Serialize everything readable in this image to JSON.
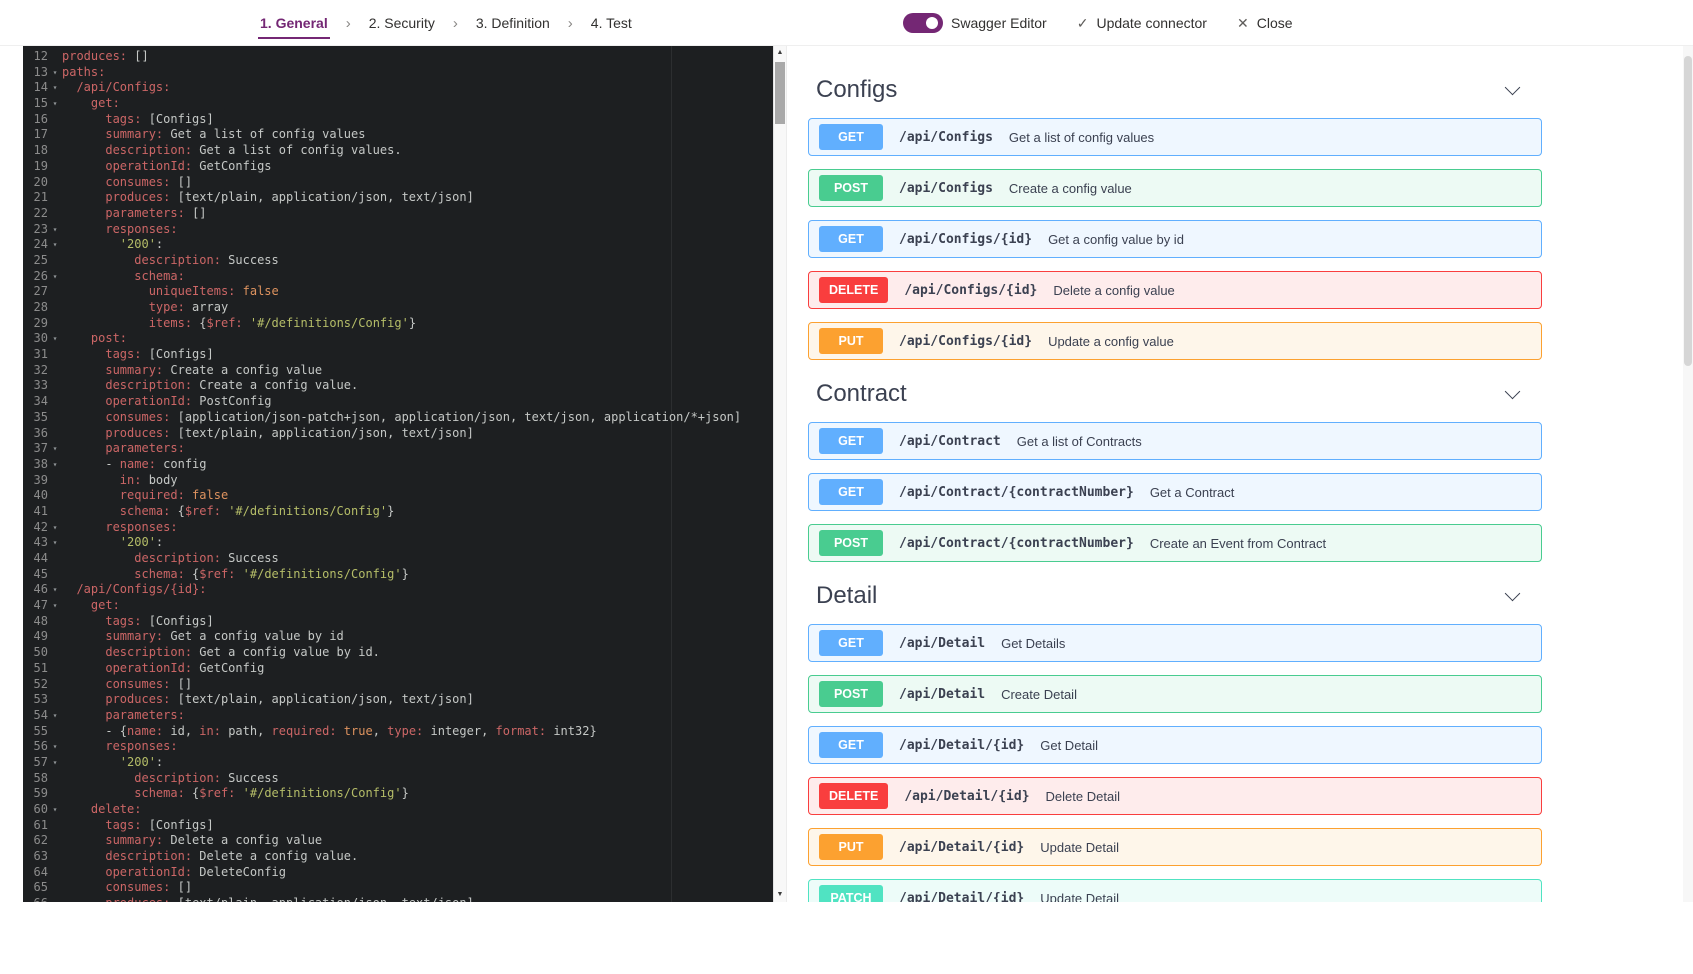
{
  "header": {
    "step_separator": "›",
    "steps": [
      {
        "label": "1. General",
        "active": true
      },
      {
        "label": "2. Security",
        "active": false
      },
      {
        "label": "3. Definition",
        "active": false
      },
      {
        "label": "4. Test",
        "active": false
      }
    ],
    "toggle": {
      "label": "Swagger Editor",
      "on": true
    },
    "actions": [
      {
        "icon": "check-icon",
        "glyph": "✓",
        "label": "Update connector"
      },
      {
        "icon": "close-icon",
        "glyph": "✕",
        "label": "Close"
      }
    ]
  },
  "scrollbar": {
    "up": "▲",
    "down": "▼"
  },
  "editor": {
    "lines": [
      {
        "n": 12,
        "f": 0,
        "t": [
          [
            "k",
            "produces:"
          ],
          [
            "p",
            " []"
          ]
        ]
      },
      {
        "n": 13,
        "f": 1,
        "t": [
          [
            "k",
            "paths:"
          ]
        ]
      },
      {
        "n": 14,
        "f": 1,
        "t": [
          [
            "p",
            "  "
          ],
          [
            "k",
            "/api/Configs:"
          ]
        ]
      },
      {
        "n": 15,
        "f": 1,
        "t": [
          [
            "p",
            "    "
          ],
          [
            "k",
            "get:"
          ]
        ]
      },
      {
        "n": 16,
        "f": 0,
        "t": [
          [
            "p",
            "      "
          ],
          [
            "k",
            "tags:"
          ],
          [
            "p",
            " [Configs]"
          ]
        ]
      },
      {
        "n": 17,
        "f": 0,
        "t": [
          [
            "p",
            "      "
          ],
          [
            "k",
            "summary:"
          ],
          [
            "p",
            " Get a list of config values"
          ]
        ]
      },
      {
        "n": 18,
        "f": 0,
        "t": [
          [
            "p",
            "      "
          ],
          [
            "k",
            "description:"
          ],
          [
            "p",
            " Get a list of config values."
          ]
        ]
      },
      {
        "n": 19,
        "f": 0,
        "t": [
          [
            "p",
            "      "
          ],
          [
            "k",
            "operationId:"
          ],
          [
            "p",
            " GetConfigs"
          ]
        ]
      },
      {
        "n": 20,
        "f": 0,
        "t": [
          [
            "p",
            "      "
          ],
          [
            "k",
            "consumes:"
          ],
          [
            "p",
            " []"
          ]
        ]
      },
      {
        "n": 21,
        "f": 0,
        "t": [
          [
            "p",
            "      "
          ],
          [
            "k",
            "produces:"
          ],
          [
            "p",
            " [text/plain, application/json, text/json]"
          ]
        ]
      },
      {
        "n": 22,
        "f": 0,
        "t": [
          [
            "p",
            "      "
          ],
          [
            "k",
            "parameters:"
          ],
          [
            "p",
            " []"
          ]
        ]
      },
      {
        "n": 23,
        "f": 1,
        "t": [
          [
            "p",
            "      "
          ],
          [
            "k",
            "responses:"
          ]
        ]
      },
      {
        "n": 24,
        "f": 1,
        "t": [
          [
            "p",
            "        "
          ],
          [
            "s",
            "'200'"
          ],
          [
            "p",
            ":"
          ]
        ]
      },
      {
        "n": 25,
        "f": 0,
        "t": [
          [
            "p",
            "          "
          ],
          [
            "k",
            "description:"
          ],
          [
            "p",
            " Success"
          ]
        ]
      },
      {
        "n": 26,
        "f": 1,
        "t": [
          [
            "p",
            "          "
          ],
          [
            "k",
            "schema:"
          ]
        ]
      },
      {
        "n": 27,
        "f": 0,
        "t": [
          [
            "p",
            "            "
          ],
          [
            "k",
            "uniqueItems:"
          ],
          [
            "c",
            " false"
          ]
        ]
      },
      {
        "n": 28,
        "f": 0,
        "t": [
          [
            "p",
            "            "
          ],
          [
            "k",
            "type:"
          ],
          [
            "p",
            " array"
          ]
        ]
      },
      {
        "n": 29,
        "f": 0,
        "t": [
          [
            "p",
            "            "
          ],
          [
            "k",
            "items:"
          ],
          [
            "p",
            " {"
          ],
          [
            "k",
            "$ref:"
          ],
          [
            "p",
            " "
          ],
          [
            "s",
            "'#/definitions/Config'"
          ],
          [
            "p",
            "}"
          ]
        ]
      },
      {
        "n": 30,
        "f": 1,
        "t": [
          [
            "p",
            "    "
          ],
          [
            "k",
            "post:"
          ]
        ]
      },
      {
        "n": 31,
        "f": 0,
        "t": [
          [
            "p",
            "      "
          ],
          [
            "k",
            "tags:"
          ],
          [
            "p",
            " [Configs]"
          ]
        ]
      },
      {
        "n": 32,
        "f": 0,
        "t": [
          [
            "p",
            "      "
          ],
          [
            "k",
            "summary:"
          ],
          [
            "p",
            " Create a config value"
          ]
        ]
      },
      {
        "n": 33,
        "f": 0,
        "t": [
          [
            "p",
            "      "
          ],
          [
            "k",
            "description:"
          ],
          [
            "p",
            " Create a config value."
          ]
        ]
      },
      {
        "n": 34,
        "f": 0,
        "t": [
          [
            "p",
            "      "
          ],
          [
            "k",
            "operationId:"
          ],
          [
            "p",
            " PostConfig"
          ]
        ]
      },
      {
        "n": 35,
        "f": 0,
        "t": [
          [
            "p",
            "      "
          ],
          [
            "k",
            "consumes:"
          ],
          [
            "p",
            " [application/json-patch+json, application/json, text/json, application/*+json]"
          ]
        ]
      },
      {
        "n": 36,
        "f": 0,
        "t": [
          [
            "p",
            "      "
          ],
          [
            "k",
            "produces:"
          ],
          [
            "p",
            " [text/plain, application/json, text/json]"
          ]
        ]
      },
      {
        "n": 37,
        "f": 1,
        "t": [
          [
            "p",
            "      "
          ],
          [
            "k",
            "parameters:"
          ]
        ]
      },
      {
        "n": 38,
        "f": 1,
        "t": [
          [
            "p",
            "      - "
          ],
          [
            "k",
            "name:"
          ],
          [
            "p",
            " config"
          ]
        ]
      },
      {
        "n": 39,
        "f": 0,
        "t": [
          [
            "p",
            "        "
          ],
          [
            "k",
            "in:"
          ],
          [
            "p",
            " body"
          ]
        ]
      },
      {
        "n": 40,
        "f": 0,
        "t": [
          [
            "p",
            "        "
          ],
          [
            "k",
            "required:"
          ],
          [
            "c",
            " false"
          ]
        ]
      },
      {
        "n": 41,
        "f": 0,
        "t": [
          [
            "p",
            "        "
          ],
          [
            "k",
            "schema:"
          ],
          [
            "p",
            " {"
          ],
          [
            "k",
            "$ref:"
          ],
          [
            "p",
            " "
          ],
          [
            "s",
            "'#/definitions/Config'"
          ],
          [
            "p",
            "}"
          ]
        ]
      },
      {
        "n": 42,
        "f": 1,
        "t": [
          [
            "p",
            "      "
          ],
          [
            "k",
            "responses:"
          ]
        ]
      },
      {
        "n": 43,
        "f": 1,
        "t": [
          [
            "p",
            "        "
          ],
          [
            "s",
            "'200'"
          ],
          [
            "p",
            ":"
          ]
        ]
      },
      {
        "n": 44,
        "f": 0,
        "t": [
          [
            "p",
            "          "
          ],
          [
            "k",
            "description:"
          ],
          [
            "p",
            " Success"
          ]
        ]
      },
      {
        "n": 45,
        "f": 0,
        "t": [
          [
            "p",
            "          "
          ],
          [
            "k",
            "schema:"
          ],
          [
            "p",
            " {"
          ],
          [
            "k",
            "$ref:"
          ],
          [
            "p",
            " "
          ],
          [
            "s",
            "'#/definitions/Config'"
          ],
          [
            "p",
            "}"
          ]
        ]
      },
      {
        "n": 46,
        "f": 1,
        "t": [
          [
            "p",
            "  "
          ],
          [
            "k",
            "/api/Configs/{id}:"
          ]
        ]
      },
      {
        "n": 47,
        "f": 1,
        "t": [
          [
            "p",
            "    "
          ],
          [
            "k",
            "get:"
          ]
        ]
      },
      {
        "n": 48,
        "f": 0,
        "t": [
          [
            "p",
            "      "
          ],
          [
            "k",
            "tags:"
          ],
          [
            "p",
            " [Configs]"
          ]
        ]
      },
      {
        "n": 49,
        "f": 0,
        "t": [
          [
            "p",
            "      "
          ],
          [
            "k",
            "summary:"
          ],
          [
            "p",
            " Get a config value by id"
          ]
        ]
      },
      {
        "n": 50,
        "f": 0,
        "t": [
          [
            "p",
            "      "
          ],
          [
            "k",
            "description:"
          ],
          [
            "p",
            " Get a config value by id."
          ]
        ]
      },
      {
        "n": 51,
        "f": 0,
        "t": [
          [
            "p",
            "      "
          ],
          [
            "k",
            "operationId:"
          ],
          [
            "p",
            " GetConfig"
          ]
        ]
      },
      {
        "n": 52,
        "f": 0,
        "t": [
          [
            "p",
            "      "
          ],
          [
            "k",
            "consumes:"
          ],
          [
            "p",
            " []"
          ]
        ]
      },
      {
        "n": 53,
        "f": 0,
        "t": [
          [
            "p",
            "      "
          ],
          [
            "k",
            "produces:"
          ],
          [
            "p",
            " [text/plain, application/json, text/json]"
          ]
        ]
      },
      {
        "n": 54,
        "f": 1,
        "t": [
          [
            "p",
            "      "
          ],
          [
            "k",
            "parameters:"
          ]
        ]
      },
      {
        "n": 55,
        "f": 0,
        "t": [
          [
            "p",
            "      - {"
          ],
          [
            "k",
            "name:"
          ],
          [
            "p",
            " id, "
          ],
          [
            "k",
            "in:"
          ],
          [
            "p",
            " path, "
          ],
          [
            "k",
            "required:"
          ],
          [
            "c",
            " true"
          ],
          [
            "p",
            ", "
          ],
          [
            "k",
            "type:"
          ],
          [
            "p",
            " integer, "
          ],
          [
            "k",
            "format:"
          ],
          [
            "p",
            " int32}"
          ]
        ]
      },
      {
        "n": 56,
        "f": 1,
        "t": [
          [
            "p",
            "      "
          ],
          [
            "k",
            "responses:"
          ]
        ]
      },
      {
        "n": 57,
        "f": 1,
        "t": [
          [
            "p",
            "        "
          ],
          [
            "s",
            "'200'"
          ],
          [
            "p",
            ":"
          ]
        ]
      },
      {
        "n": 58,
        "f": 0,
        "t": [
          [
            "p",
            "          "
          ],
          [
            "k",
            "description:"
          ],
          [
            "p",
            " Success"
          ]
        ]
      },
      {
        "n": 59,
        "f": 0,
        "t": [
          [
            "p",
            "          "
          ],
          [
            "k",
            "schema:"
          ],
          [
            "p",
            " {"
          ],
          [
            "k",
            "$ref:"
          ],
          [
            "p",
            " "
          ],
          [
            "s",
            "'#/definitions/Config'"
          ],
          [
            "p",
            "}"
          ]
        ]
      },
      {
        "n": 60,
        "f": 1,
        "t": [
          [
            "p",
            "    "
          ],
          [
            "k",
            "delete:"
          ]
        ]
      },
      {
        "n": 61,
        "f": 0,
        "t": [
          [
            "p",
            "      "
          ],
          [
            "k",
            "tags:"
          ],
          [
            "p",
            " [Configs]"
          ]
        ]
      },
      {
        "n": 62,
        "f": 0,
        "t": [
          [
            "p",
            "      "
          ],
          [
            "k",
            "summary:"
          ],
          [
            "p",
            " Delete a config value"
          ]
        ]
      },
      {
        "n": 63,
        "f": 0,
        "t": [
          [
            "p",
            "      "
          ],
          [
            "k",
            "description:"
          ],
          [
            "p",
            " Delete a config value."
          ]
        ]
      },
      {
        "n": 64,
        "f": 0,
        "t": [
          [
            "p",
            "      "
          ],
          [
            "k",
            "operationId:"
          ],
          [
            "p",
            " DeleteConfig"
          ]
        ]
      },
      {
        "n": 65,
        "f": 0,
        "t": [
          [
            "p",
            "      "
          ],
          [
            "k",
            "consumes:"
          ],
          [
            "p",
            " []"
          ]
        ]
      },
      {
        "n": 66,
        "f": 0,
        "t": [
          [
            "p",
            "      "
          ],
          [
            "k",
            "produces:"
          ],
          [
            "p",
            " [text/plain, application/json, text/json]"
          ]
        ]
      }
    ]
  },
  "preview": {
    "sections": [
      {
        "title": "Configs",
        "operations": [
          {
            "method": "GET",
            "path": "/api/Configs",
            "summary": "Get a list of config values"
          },
          {
            "method": "POST",
            "path": "/api/Configs",
            "summary": "Create a config value"
          },
          {
            "method": "GET",
            "path": "/api/Configs/{id}",
            "summary": "Get a config value by id"
          },
          {
            "method": "DELETE",
            "path": "/api/Configs/{id}",
            "summary": "Delete a config value"
          },
          {
            "method": "PUT",
            "path": "/api/Configs/{id}",
            "summary": "Update a config value"
          }
        ]
      },
      {
        "title": "Contract",
        "operations": [
          {
            "method": "GET",
            "path": "/api/Contract",
            "summary": "Get a list of Contracts"
          },
          {
            "method": "GET",
            "path": "/api/Contract/{contractNumber}",
            "summary": "Get a Contract"
          },
          {
            "method": "POST",
            "path": "/api/Contract/{contractNumber}",
            "summary": "Create an Event from Contract"
          }
        ]
      },
      {
        "title": "Detail",
        "operations": [
          {
            "method": "GET",
            "path": "/api/Detail",
            "summary": "Get Details"
          },
          {
            "method": "POST",
            "path": "/api/Detail",
            "summary": "Create Detail"
          },
          {
            "method": "GET",
            "path": "/api/Detail/{id}",
            "summary": "Get Detail"
          },
          {
            "method": "DELETE",
            "path": "/api/Detail/{id}",
            "summary": "Delete Detail"
          },
          {
            "method": "PUT",
            "path": "/api/Detail/{id}",
            "summary": "Update Detail"
          },
          {
            "method": "PATCH",
            "path": "/api/Detail/{id}",
            "summary": "Update Detail"
          }
        ]
      }
    ]
  },
  "colors": {
    "accent": "#742774",
    "editor_bg": "#1d1f21",
    "methods": {
      "GET": {
        "badge": "#61affe",
        "bg": "#eff7ff"
      },
      "POST": {
        "badge": "#49cc90",
        "bg": "#edfaf4"
      },
      "DELETE": {
        "badge": "#f93e3e",
        "bg": "#feecec"
      },
      "PUT": {
        "badge": "#fca130",
        "bg": "#fef6ea"
      },
      "PATCH": {
        "badge": "#50e3c2",
        "bg": "#edfcf9"
      }
    }
  }
}
